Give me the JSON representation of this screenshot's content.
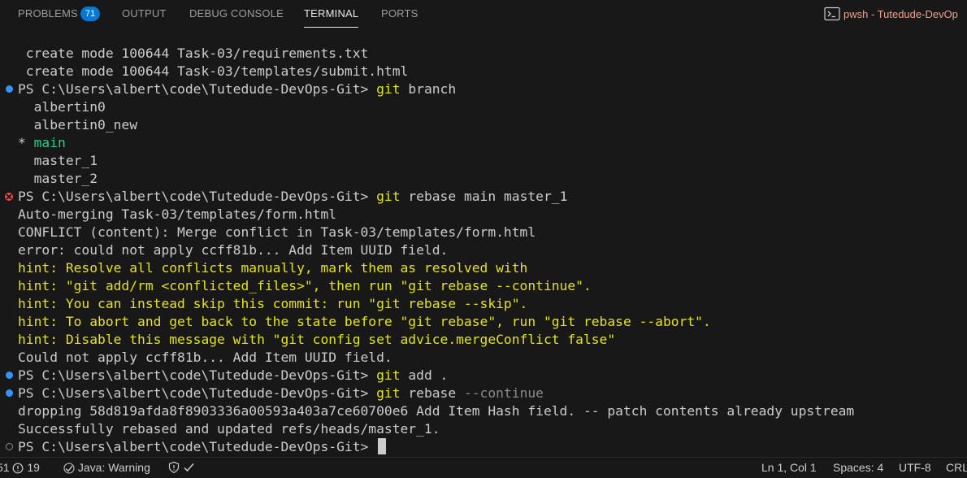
{
  "tabs": [
    {
      "label": "PROBLEMS",
      "badge": "71"
    },
    {
      "label": "OUTPUT"
    },
    {
      "label": "DEBUG CONSOLE"
    },
    {
      "label": "TERMINAL"
    },
    {
      "label": "PORTS"
    }
  ],
  "shell": {
    "label": "pwsh - Tutedude-DevOp"
  },
  "terminal": {
    "prompt": "PS C:\\Users\\albert\\code\\Tutedude-DevOps-Git> ",
    "lines": [
      {
        "text": " create mode 100644 Task-03/requirements.txt"
      },
      {
        "text": " create mode 100644 Task-03/templates/submit.html"
      },
      {
        "cmd": "git",
        "args": " branch"
      },
      {
        "text": "  albertin0"
      },
      {
        "text": "  albertin0_new"
      },
      {
        "marker": "* ",
        "branch": "main"
      },
      {
        "text": "  master_1"
      },
      {
        "text": "  master_2"
      },
      {
        "cmd": "git",
        "args": " rebase main master_1"
      },
      {
        "text": "Auto-merging Task-03/templates/form.html"
      },
      {
        "text": "CONFLICT (content): Merge conflict in Task-03/templates/form.html"
      },
      {
        "text": "error: could not apply ccff81b... Add Item UUID field."
      },
      {
        "text": "hint: Resolve all conflicts manually, mark them as resolved with"
      },
      {
        "text": "hint: \"git add/rm <conflicted_files>\", then run \"git rebase --continue\"."
      },
      {
        "text": "hint: You can instead skip this commit: run \"git rebase --skip\"."
      },
      {
        "text": "hint: To abort and get back to the state before \"git rebase\", run \"git rebase --abort\"."
      },
      {
        "text": "hint: Disable this message with \"git config set advice.mergeConflict false\""
      },
      {
        "text": "Could not apply ccff81b... Add Item UUID field."
      },
      {
        "cmd": "git",
        "args": " add ."
      },
      {
        "cmd": "git",
        "args": " rebase ",
        "flag": "--continue"
      },
      {
        "text": "dropping 58d819afda8f8903336a00593a403a7ce60700e6 Add Item Hash field. -- patch contents already upstream"
      },
      {
        "text": "Successfully rebased and updated refs/heads/master_1."
      },
      {
        "text": ""
      }
    ]
  },
  "status": {
    "errors": "51",
    "warnings": "19",
    "java": "Java: Warning",
    "position": "Ln 1, Col 1",
    "spaces": "Spaces: 4",
    "encoding": "UTF-8",
    "eol": "CRL"
  },
  "colors": {
    "background": "#181818",
    "accent": "#0078d4",
    "hint_yellow": "#e5e510",
    "branch_green": "#23d18b",
    "error_red": "#f14c4c",
    "ok_blue": "#3794ff"
  }
}
